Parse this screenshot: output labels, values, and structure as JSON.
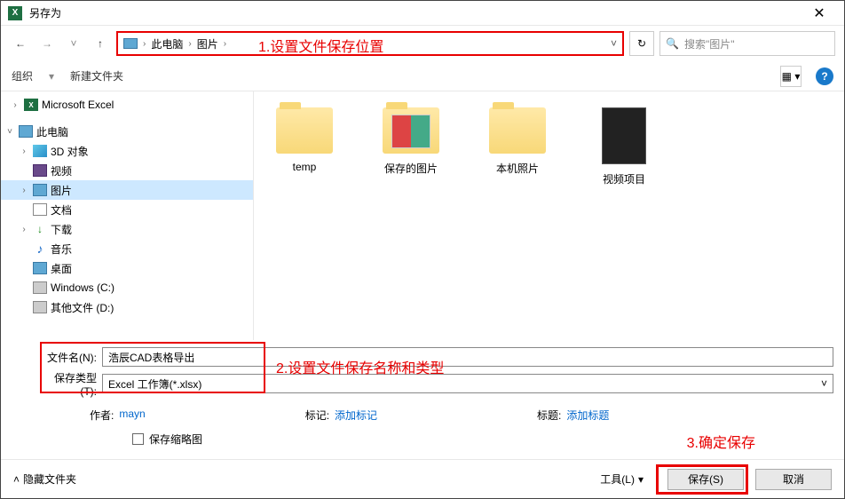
{
  "window": {
    "title": "另存为"
  },
  "nav": {
    "breadcrumb": {
      "root": "此电脑",
      "folder": "图片"
    },
    "search_placeholder": "搜索\"图片\""
  },
  "annotations": {
    "a1": "1.设置文件保存位置",
    "a2": "2.设置文件保存名称和类型",
    "a3": "3.确定保存"
  },
  "toolbar": {
    "organize": "组织",
    "new_folder": "新建文件夹"
  },
  "sidebar": {
    "excel": "Microsoft Excel",
    "pc": "此电脑",
    "d3": "3D 对象",
    "video": "视频",
    "pictures": "图片",
    "documents": "文档",
    "downloads": "下载",
    "music": "音乐",
    "desktop": "桌面",
    "cdrive": "Windows (C:)",
    "ddrive": "其他文件 (D:)"
  },
  "files": {
    "f1": "temp",
    "f2": "保存的图片",
    "f3": "本机照片",
    "f4": "视频项目"
  },
  "form": {
    "filename_label": "文件名(N):",
    "filename_value": "浩辰CAD表格导出",
    "filetype_label": "保存类型(T):",
    "filetype_value": "Excel 工作簿(*.xlsx)"
  },
  "meta": {
    "author_label": "作者:",
    "author_value": "mayn",
    "tags_label": "标记:",
    "tags_value": "添加标记",
    "title_label": "标题:",
    "title_value": "添加标题",
    "save_thumb": "保存缩略图"
  },
  "buttons": {
    "hide_folders": "隐藏文件夹",
    "tools": "工具(L)",
    "save": "保存(S)",
    "cancel": "取消"
  }
}
